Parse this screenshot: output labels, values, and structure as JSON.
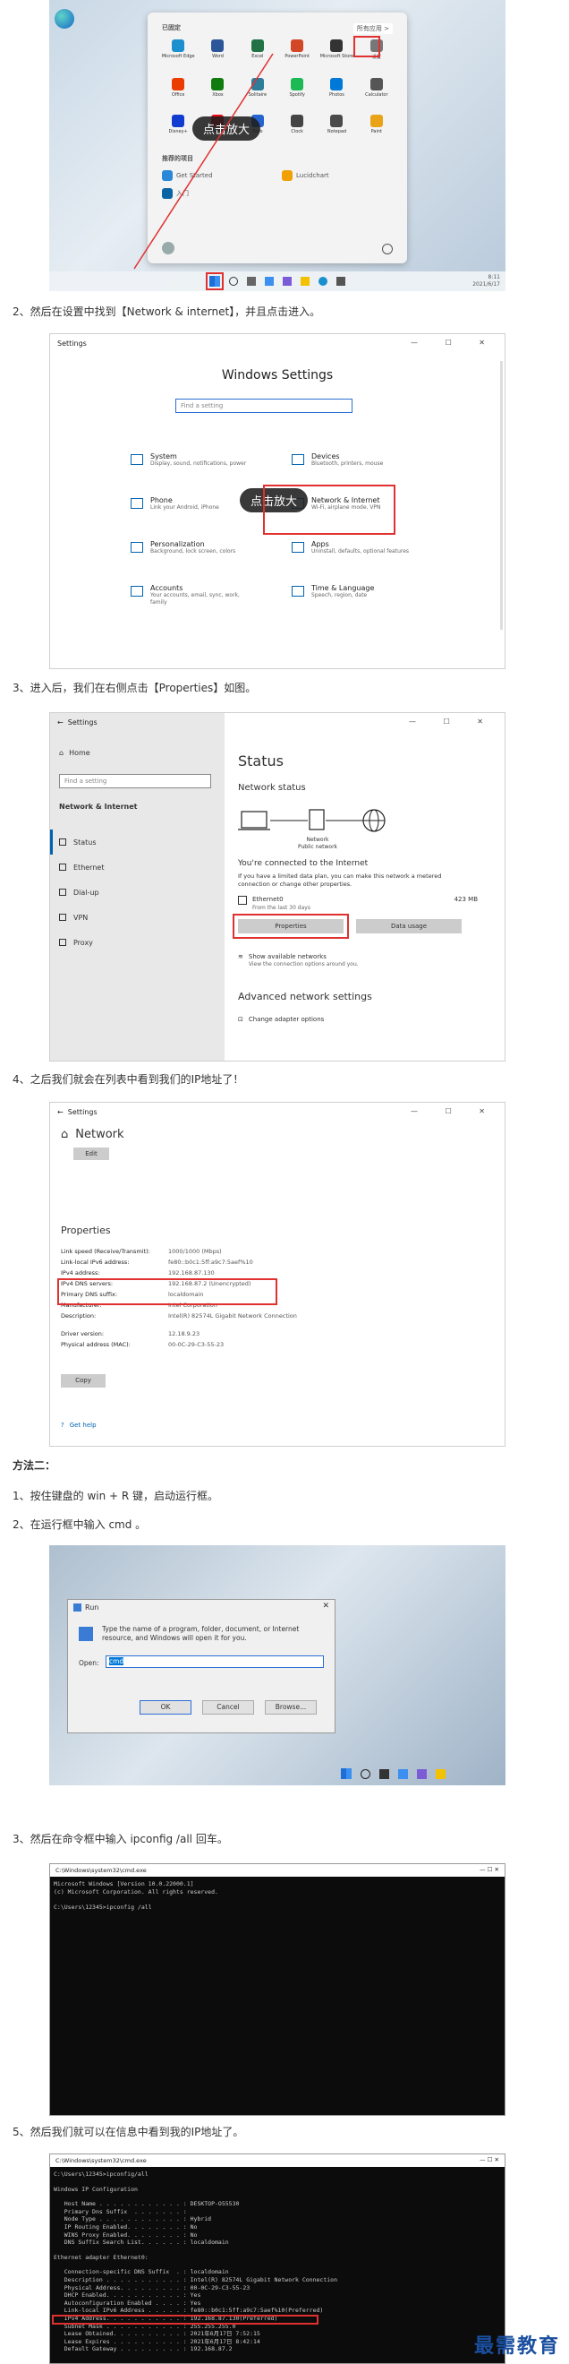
{
  "shot1": {
    "pinned_label": "已固定",
    "all_apps": "所有应用 >",
    "apps": [
      "Microsoft Edge",
      "Word",
      "Excel",
      "PowerPoint",
      "Microsoft Store",
      "设置",
      "Office",
      "Xbox",
      "Solitaire",
      "Spotify",
      "Photos",
      "Calculator",
      "Disney+",
      "Netflix",
      "Todo",
      "Clock",
      "Notepad",
      "Paint"
    ],
    "recommended": "推荐的项目",
    "rec_items": [
      "Get Started",
      "入门",
      "Lucidchart"
    ],
    "zoom": "点击放大",
    "time": "8:11",
    "date": "2021/6/17"
  },
  "step2": "2、然后在设置中找到【Network & internet】，并且点击进入。",
  "shot2": {
    "window_title": "Settings",
    "header": "Windows Settings",
    "search_placeholder": "Find a setting",
    "zoom": "点击放大",
    "items": [
      {
        "title": "System",
        "desc": "Display, sound, notifications, power"
      },
      {
        "title": "Devices",
        "desc": "Bluetooth, printers, mouse"
      },
      {
        "title": "Phone",
        "desc": "Link your Android, iPhone"
      },
      {
        "title": "Network & Internet",
        "desc": "Wi-Fi, airplane mode, VPN"
      },
      {
        "title": "Personalization",
        "desc": "Background, lock screen, colors"
      },
      {
        "title": "Apps",
        "desc": "Uninstall, defaults, optional features"
      },
      {
        "title": "Accounts",
        "desc": "Your accounts, email, sync, work, family"
      },
      {
        "title": "Time & Language",
        "desc": "Speech, region, date"
      }
    ]
  },
  "step3": "3、进入后，我们在右侧点击【Properties】如图。",
  "shot3": {
    "window_title": "Settings",
    "home": "Home",
    "search_placeholder": "Find a setting",
    "section": "Network & Internet",
    "nav": [
      "Status",
      "Ethernet",
      "Dial-up",
      "VPN",
      "Proxy"
    ],
    "page_title": "Status",
    "net_status": "Network status",
    "net_label": "Network",
    "net_sub": "Public network",
    "connected": "You're connected to the Internet",
    "limited": "If you have a limited data plan, you can make this network a metered connection or change other properties.",
    "adapter": "Ethernet0",
    "adapter_sub": "From the last 30 days",
    "usage": "423 MB",
    "btn_properties": "Properties",
    "btn_usage": "Data usage",
    "show_available": "Show available networks",
    "show_available_sub": "View the connection options around you.",
    "advanced": "Advanced network settings",
    "change_adapter": "Change adapter options"
  },
  "step4": "4、之后我们就会在列表中看到我们的IP地址了！",
  "shot4": {
    "window_title": "Settings",
    "header": "Network",
    "edit": "Edit",
    "properties": "Properties",
    "rows": [
      {
        "k": "Link speed (Receive/Transmit):",
        "v": "1000/1000 (Mbps)"
      },
      {
        "k": "Link-local IPv6 address:",
        "v": "fe80::b0c1:5ff:a9c7:5aef%10"
      },
      {
        "k": "IPv4 address:",
        "v": "192.168.87.130"
      },
      {
        "k": "IPv4 DNS servers:",
        "v": "192.168.87.2 (Unencrypted)"
      },
      {
        "k": "Primary DNS suffix:",
        "v": "localdomain"
      },
      {
        "k": "Manufacturer:",
        "v": "Intel Corporation"
      },
      {
        "k": "Description:",
        "v": "Intel(R) 82574L Gigabit Network Connection"
      },
      {
        "k": "Driver version:",
        "v": "12.18.9.23"
      },
      {
        "k": "Physical address (MAC):",
        "v": "00-0C-29-C3-55-23"
      }
    ],
    "copy": "Copy",
    "help": "Get help"
  },
  "method2": "方法二：",
  "step2_1": "1、按住键盘的 win + R 键，启动运行框。",
  "step2_2": "2、在运行框中输入 cmd 。",
  "shot5": {
    "title": "Run",
    "desc": "Type the name of a program, folder, document, or Internet resource, and Windows will open it for you.",
    "open_label": "Open:",
    "input": "cmd",
    "ok": "OK",
    "cancel": "Cancel",
    "browse": "Browse..."
  },
  "step2_3": "3、然后在命令框中输入 ipconfig /all 回车。",
  "shot6": {
    "title": "C:\\Windows\\system32\\cmd.exe",
    "lines": [
      "Microsoft Windows [Version 10.0.22000.1]",
      "(c) Microsoft Corporation. All rights reserved.",
      "",
      "C:\\Users\\12345>ipconfig /all"
    ]
  },
  "step2_5": "5、然后我们就可以在信息中看到我的IP地址了。",
  "shot7": {
    "title": "C:\\Windows\\system32\\cmd.exe",
    "lines": [
      "C:\\Users\\12345>ipconfig/all",
      "",
      "Windows IP Configuration",
      "",
      "   Host Name . . . . . . . . . . . . : DESKTOP-O55530",
      "   Primary Dns Suffix  . . . . . . . :",
      "   Node Type . . . . . . . . . . . . : Hybrid",
      "   IP Routing Enabled. . . . . . . . : No",
      "   WINS Proxy Enabled. . . . . . . . : No",
      "   DNS Suffix Search List. . . . . . : localdomain",
      "",
      "Ethernet adapter Ethernet0:",
      "",
      "   Connection-specific DNS Suffix  . : localdomain",
      "   Description . . . . . . . . . . . : Intel(R) 82574L Gigabit Network Connection",
      "   Physical Address. . . . . . . . . : 00-0C-29-C3-55-23",
      "   DHCP Enabled. . . . . . . . . . . : Yes",
      "   Autoconfiguration Enabled . . . . : Yes",
      "   Link-local IPv6 Address . . . . . : fe80::b0c1:5ff:a9c7:5aef%10(Preferred)",
      "   IPv4 Address. . . . . . . . . . . : 192.168.87.130(Preferred)",
      "   Subnet Mask . . . . . . . . . . . : 255.255.255.0",
      "   Lease Obtained. . . . . . . . . . : 2021年6月17日 7:52:15",
      "   Lease Expires . . . . . . . . . . : 2021年6月17日 8:42:14",
      "   Default Gateway . . . . . . . . . : 192.168.87.2"
    ]
  },
  "watermark": "最需教育"
}
